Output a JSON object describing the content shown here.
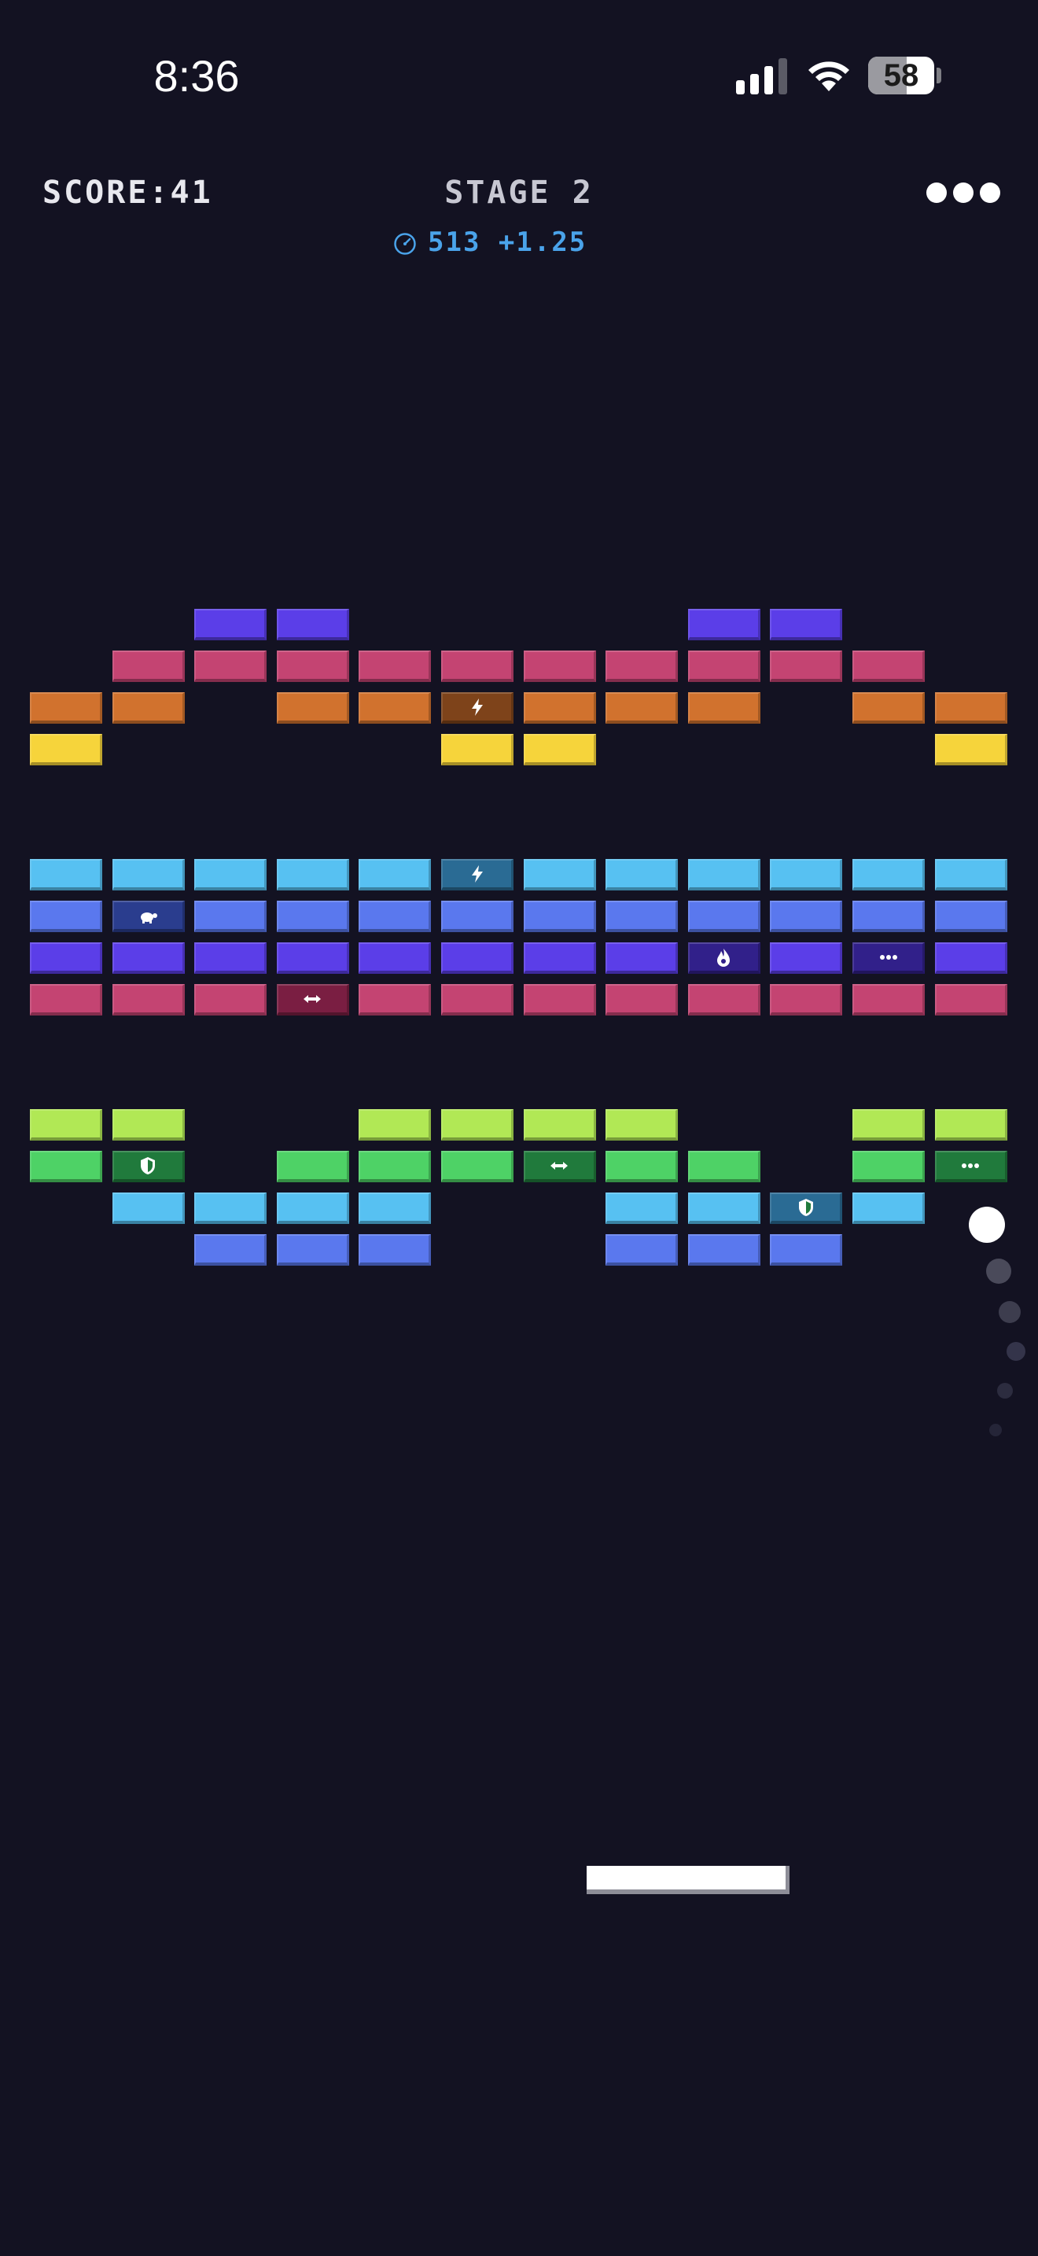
{
  "status_bar": {
    "time": "8:36",
    "battery_percent": "58",
    "battery_level": 0.58,
    "signal_bars": 3
  },
  "hud": {
    "score_label": "SCORE:41",
    "stage_label": "STAGE 2",
    "speed_value": "513",
    "speed_bonus": "+1.25",
    "menu_icon": "more-dots-icon",
    "speed_icon": "speedometer-icon"
  },
  "colors": {
    "background": "#131222",
    "violet": "#5b3ee8",
    "pink": "#c44472",
    "orange": "#d1722e",
    "yellow": "#f6d43b",
    "cyan": "#57c1f2",
    "blue": "#5a78ee",
    "lime": "#b1e855",
    "green": "#4ed266",
    "speed_text": "#4aa3ea"
  },
  "powerup_colors": {
    "orange": "#7e431a",
    "cyan": "#2a6b94",
    "blue": "#2a3d8e",
    "violet": "#31208a",
    "pink": "#7a1e42",
    "green": "#207a3c"
  },
  "powerup_icons": {
    "lightning": "lightning-icon",
    "turtle": "turtle-icon",
    "flame": "flame-icon",
    "multi": "multi-ball-icon",
    "expand": "expand-arrows-icon",
    "shield": "shield-icon"
  },
  "bricks": [
    {
      "row": 0,
      "col": 2,
      "color": "violet"
    },
    {
      "row": 0,
      "col": 3,
      "color": "violet"
    },
    {
      "row": 0,
      "col": 8,
      "color": "violet"
    },
    {
      "row": 0,
      "col": 9,
      "color": "violet"
    },
    {
      "row": 1,
      "col": 1,
      "color": "pink"
    },
    {
      "row": 1,
      "col": 2,
      "color": "pink"
    },
    {
      "row": 1,
      "col": 3,
      "color": "pink"
    },
    {
      "row": 1,
      "col": 4,
      "color": "pink"
    },
    {
      "row": 1,
      "col": 5,
      "color": "pink"
    },
    {
      "row": 1,
      "col": 6,
      "color": "pink"
    },
    {
      "row": 1,
      "col": 7,
      "color": "pink"
    },
    {
      "row": 1,
      "col": 8,
      "color": "pink"
    },
    {
      "row": 1,
      "col": 9,
      "color": "pink"
    },
    {
      "row": 1,
      "col": 10,
      "color": "pink"
    },
    {
      "row": 2,
      "col": 0,
      "color": "orange"
    },
    {
      "row": 2,
      "col": 1,
      "color": "orange"
    },
    {
      "row": 2,
      "col": 3,
      "color": "orange"
    },
    {
      "row": 2,
      "col": 4,
      "color": "orange"
    },
    {
      "row": 2,
      "col": 5,
      "color": "orange",
      "powerup": "lightning"
    },
    {
      "row": 2,
      "col": 6,
      "color": "orange"
    },
    {
      "row": 2,
      "col": 7,
      "color": "orange"
    },
    {
      "row": 2,
      "col": 8,
      "color": "orange"
    },
    {
      "row": 2,
      "col": 10,
      "color": "orange"
    },
    {
      "row": 2,
      "col": 11,
      "color": "orange"
    },
    {
      "row": 3,
      "col": 0,
      "color": "yellow"
    },
    {
      "row": 3,
      "col": 5,
      "color": "yellow"
    },
    {
      "row": 3,
      "col": 6,
      "color": "yellow"
    },
    {
      "row": 3,
      "col": 11,
      "color": "yellow"
    },
    {
      "row": 6,
      "col": 0,
      "color": "cyan"
    },
    {
      "row": 6,
      "col": 1,
      "color": "cyan"
    },
    {
      "row": 6,
      "col": 2,
      "color": "cyan"
    },
    {
      "row": 6,
      "col": 3,
      "color": "cyan"
    },
    {
      "row": 6,
      "col": 4,
      "color": "cyan"
    },
    {
      "row": 6,
      "col": 5,
      "color": "cyan",
      "powerup": "lightning"
    },
    {
      "row": 6,
      "col": 6,
      "color": "cyan"
    },
    {
      "row": 6,
      "col": 7,
      "color": "cyan"
    },
    {
      "row": 6,
      "col": 8,
      "color": "cyan"
    },
    {
      "row": 6,
      "col": 9,
      "color": "cyan"
    },
    {
      "row": 6,
      "col": 10,
      "color": "cyan"
    },
    {
      "row": 6,
      "col": 11,
      "color": "cyan"
    },
    {
      "row": 7,
      "col": 0,
      "color": "blue"
    },
    {
      "row": 7,
      "col": 1,
      "color": "blue",
      "powerup": "turtle"
    },
    {
      "row": 7,
      "col": 2,
      "color": "blue"
    },
    {
      "row": 7,
      "col": 3,
      "color": "blue"
    },
    {
      "row": 7,
      "col": 4,
      "color": "blue"
    },
    {
      "row": 7,
      "col": 5,
      "color": "blue"
    },
    {
      "row": 7,
      "col": 6,
      "color": "blue"
    },
    {
      "row": 7,
      "col": 7,
      "color": "blue"
    },
    {
      "row": 7,
      "col": 8,
      "color": "blue"
    },
    {
      "row": 7,
      "col": 9,
      "color": "blue"
    },
    {
      "row": 7,
      "col": 10,
      "color": "blue"
    },
    {
      "row": 7,
      "col": 11,
      "color": "blue"
    },
    {
      "row": 8,
      "col": 0,
      "color": "violet"
    },
    {
      "row": 8,
      "col": 1,
      "color": "violet"
    },
    {
      "row": 8,
      "col": 2,
      "color": "violet"
    },
    {
      "row": 8,
      "col": 3,
      "color": "violet"
    },
    {
      "row": 8,
      "col": 4,
      "color": "violet"
    },
    {
      "row": 8,
      "col": 5,
      "color": "violet"
    },
    {
      "row": 8,
      "col": 6,
      "color": "violet"
    },
    {
      "row": 8,
      "col": 7,
      "color": "violet"
    },
    {
      "row": 8,
      "col": 8,
      "color": "violet",
      "powerup": "flame"
    },
    {
      "row": 8,
      "col": 9,
      "color": "violet"
    },
    {
      "row": 8,
      "col": 10,
      "color": "violet",
      "powerup": "multi"
    },
    {
      "row": 8,
      "col": 11,
      "color": "violet"
    },
    {
      "row": 9,
      "col": 0,
      "color": "pink"
    },
    {
      "row": 9,
      "col": 1,
      "color": "pink"
    },
    {
      "row": 9,
      "col": 2,
      "color": "pink"
    },
    {
      "row": 9,
      "col": 3,
      "color": "pink",
      "powerup": "expand"
    },
    {
      "row": 9,
      "col": 4,
      "color": "pink"
    },
    {
      "row": 9,
      "col": 5,
      "color": "pink"
    },
    {
      "row": 9,
      "col": 6,
      "color": "pink"
    },
    {
      "row": 9,
      "col": 7,
      "color": "pink"
    },
    {
      "row": 9,
      "col": 8,
      "color": "pink"
    },
    {
      "row": 9,
      "col": 9,
      "color": "pink"
    },
    {
      "row": 9,
      "col": 10,
      "color": "pink"
    },
    {
      "row": 9,
      "col": 11,
      "color": "pink"
    },
    {
      "row": 12,
      "col": 0,
      "color": "lime"
    },
    {
      "row": 12,
      "col": 1,
      "color": "lime"
    },
    {
      "row": 12,
      "col": 4,
      "color": "lime"
    },
    {
      "row": 12,
      "col": 5,
      "color": "lime"
    },
    {
      "row": 12,
      "col": 6,
      "color": "lime"
    },
    {
      "row": 12,
      "col": 7,
      "color": "lime"
    },
    {
      "row": 12,
      "col": 10,
      "color": "lime"
    },
    {
      "row": 12,
      "col": 11,
      "color": "lime"
    },
    {
      "row": 13,
      "col": 0,
      "color": "green"
    },
    {
      "row": 13,
      "col": 1,
      "color": "green",
      "powerup": "shield"
    },
    {
      "row": 13,
      "col": 3,
      "color": "green"
    },
    {
      "row": 13,
      "col": 4,
      "color": "green"
    },
    {
      "row": 13,
      "col": 5,
      "color": "green"
    },
    {
      "row": 13,
      "col": 6,
      "color": "green",
      "powerup": "expand"
    },
    {
      "row": 13,
      "col": 7,
      "color": "green"
    },
    {
      "row": 13,
      "col": 8,
      "color": "green"
    },
    {
      "row": 13,
      "col": 10,
      "color": "green"
    },
    {
      "row": 13,
      "col": 11,
      "color": "green",
      "powerup": "multi"
    },
    {
      "row": 14,
      "col": 1,
      "color": "cyan"
    },
    {
      "row": 14,
      "col": 2,
      "color": "cyan"
    },
    {
      "row": 14,
      "col": 3,
      "color": "cyan"
    },
    {
      "row": 14,
      "col": 4,
      "color": "cyan"
    },
    {
      "row": 14,
      "col": 7,
      "color": "cyan"
    },
    {
      "row": 14,
      "col": 8,
      "color": "cyan"
    },
    {
      "row": 14,
      "col": 9,
      "color": "cyan",
      "powerup": "shield"
    },
    {
      "row": 14,
      "col": 10,
      "color": "cyan"
    },
    {
      "row": 15,
      "col": 2,
      "color": "blue"
    },
    {
      "row": 15,
      "col": 3,
      "color": "blue"
    },
    {
      "row": 15,
      "col": 4,
      "color": "blue"
    },
    {
      "row": 15,
      "col": 7,
      "color": "blue"
    },
    {
      "row": 15,
      "col": 8,
      "color": "blue"
    },
    {
      "row": 15,
      "col": 9,
      "color": "blue"
    }
  ]
}
